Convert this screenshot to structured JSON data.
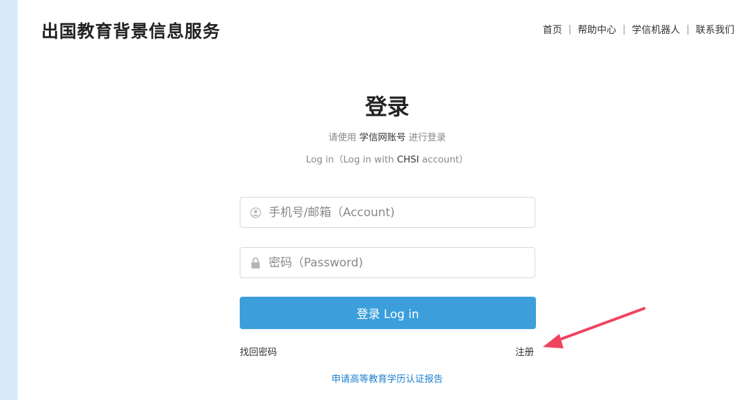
{
  "header": {
    "title": "出国教育背景信息服务",
    "nav": [
      {
        "label": "首页"
      },
      {
        "label": "帮助中心"
      },
      {
        "label": "学信机器人"
      },
      {
        "label": "联系我们"
      }
    ],
    "separator": "|"
  },
  "login": {
    "title": "登录",
    "subtitle_prefix": "请使用 ",
    "subtitle_strong": "学信网账号",
    "subtitle_suffix": " 进行登录",
    "subtitle_en_prefix": "Log in（Log in with ",
    "subtitle_en_strong": "CHSI",
    "subtitle_en_suffix": " account）",
    "account_placeholder": "手机号/邮箱（Account)",
    "password_placeholder": "密码（Password)",
    "button_label": "登录 Log in",
    "forgot_label": "找回密码",
    "register_label": "注册",
    "apply_label": "申请高等教育学历认证报告"
  },
  "colors": {
    "accent": "#3c9fdc",
    "annotation_arrow": "#f0435e",
    "left_strip": "#d9ebf8"
  },
  "icons": {
    "account": "user-circle-icon",
    "password": "lock-icon",
    "annotation": "red-arrow-icon"
  }
}
